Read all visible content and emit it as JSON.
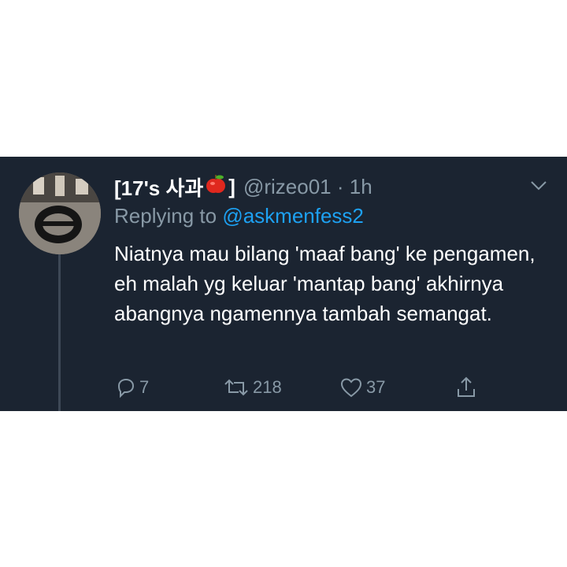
{
  "tweet": {
    "display_name": "[17's 사과",
    "display_name_suffix": "]",
    "handle": "@rizeo01",
    "separator": "·",
    "time": "1h",
    "replying_prefix": "Replying to",
    "replying_to": "@askmenfess2",
    "text": "Niatnya mau bilang 'maaf bang' ke pengamen, eh malah yg keluar 'mantap bang' akhirnya abangnya ngamennya tambah semangat.",
    "actions": {
      "reply_count": "7",
      "retweet_count": "218",
      "like_count": "37"
    }
  },
  "colors": {
    "background": "#1b2431",
    "text_primary": "#ffffff",
    "text_secondary": "#8899a6",
    "link": "#1da1f2",
    "thread_line": "#3d4856"
  },
  "icons": [
    "apple-emoji",
    "chevron-down-icon",
    "reply-icon",
    "retweet-icon",
    "like-icon",
    "share-icon"
  ]
}
